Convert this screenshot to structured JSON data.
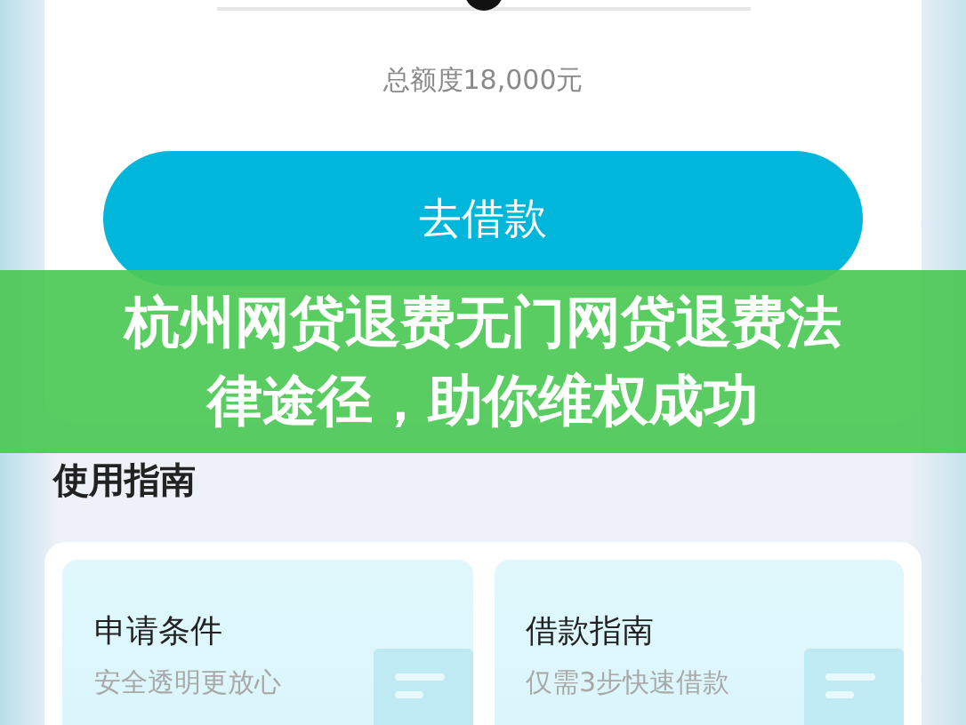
{
  "amount_slider": {
    "level": 0.5
  },
  "total_limit": "总额度18,000元",
  "borrow_button": "去借款",
  "banner_title": "杭州网贷退费无门网贷退费法律途径，助你维权成功",
  "guide": {
    "heading": "使用指南",
    "cards": [
      {
        "title": "申请条件",
        "subtitle": "安全透明更放心"
      },
      {
        "title": "借款指南",
        "subtitle": "仅需3步快速借款"
      }
    ]
  }
}
